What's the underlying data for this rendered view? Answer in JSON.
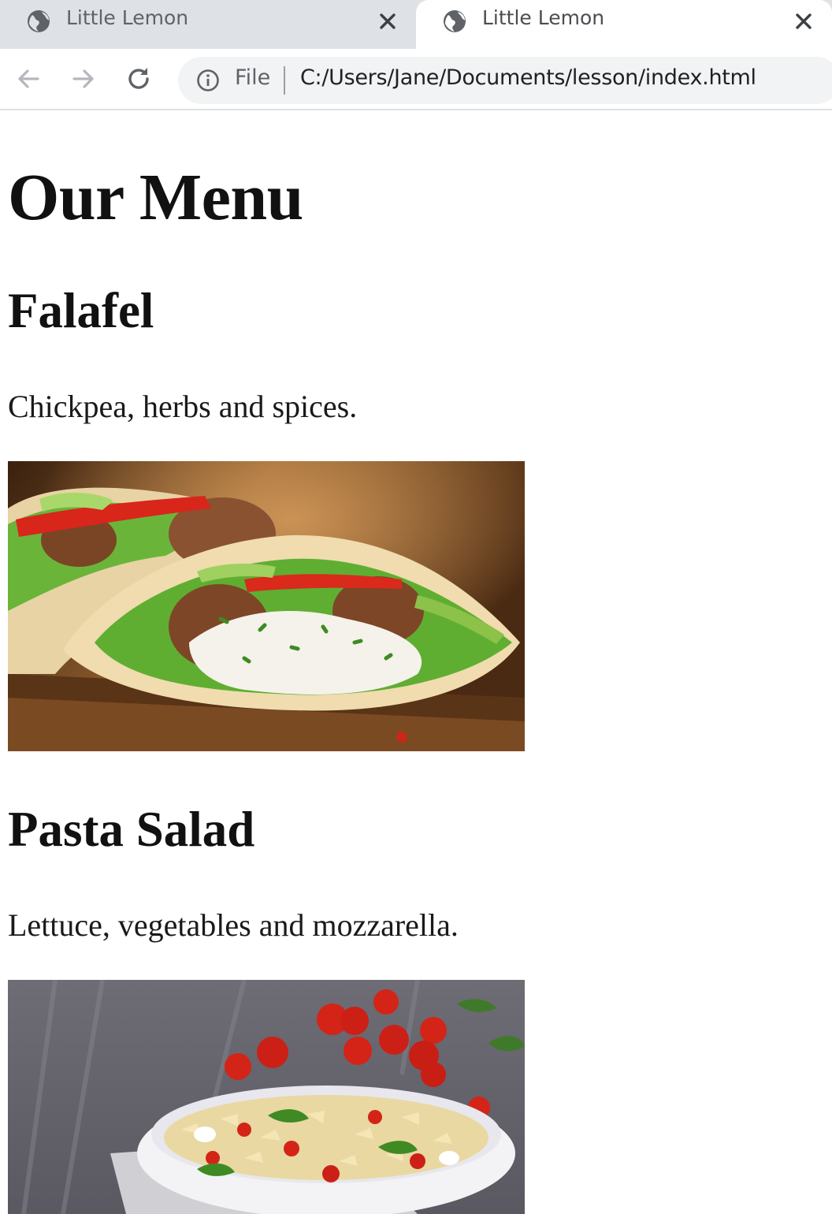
{
  "browser": {
    "tabs": [
      {
        "title": "Little Lemon",
        "active": false,
        "icon": "globe-icon"
      },
      {
        "title": "Little Lemon",
        "active": true,
        "icon": "globe-icon"
      }
    ],
    "address_bar": {
      "scheme_label": "File",
      "url": "C:/Users/Jane/Documents/lesson/index.html",
      "icon": "info-icon"
    },
    "nav_icons": [
      "back-arrow-icon",
      "forward-arrow-icon",
      "reload-icon"
    ]
  },
  "page": {
    "title": "Our Menu",
    "items": [
      {
        "name": "Falafel",
        "description": "Chickpea, herbs and spices.",
        "image": "falafel-image"
      },
      {
        "name": "Pasta Salad",
        "description": "Lettuce, vegetables and mozzarella.",
        "image": "pasta-salad-image"
      }
    ]
  },
  "colors": {
    "tabstrip": "#dee1e6",
    "omnibox": "#f1f3f4",
    "text": "#111111"
  }
}
